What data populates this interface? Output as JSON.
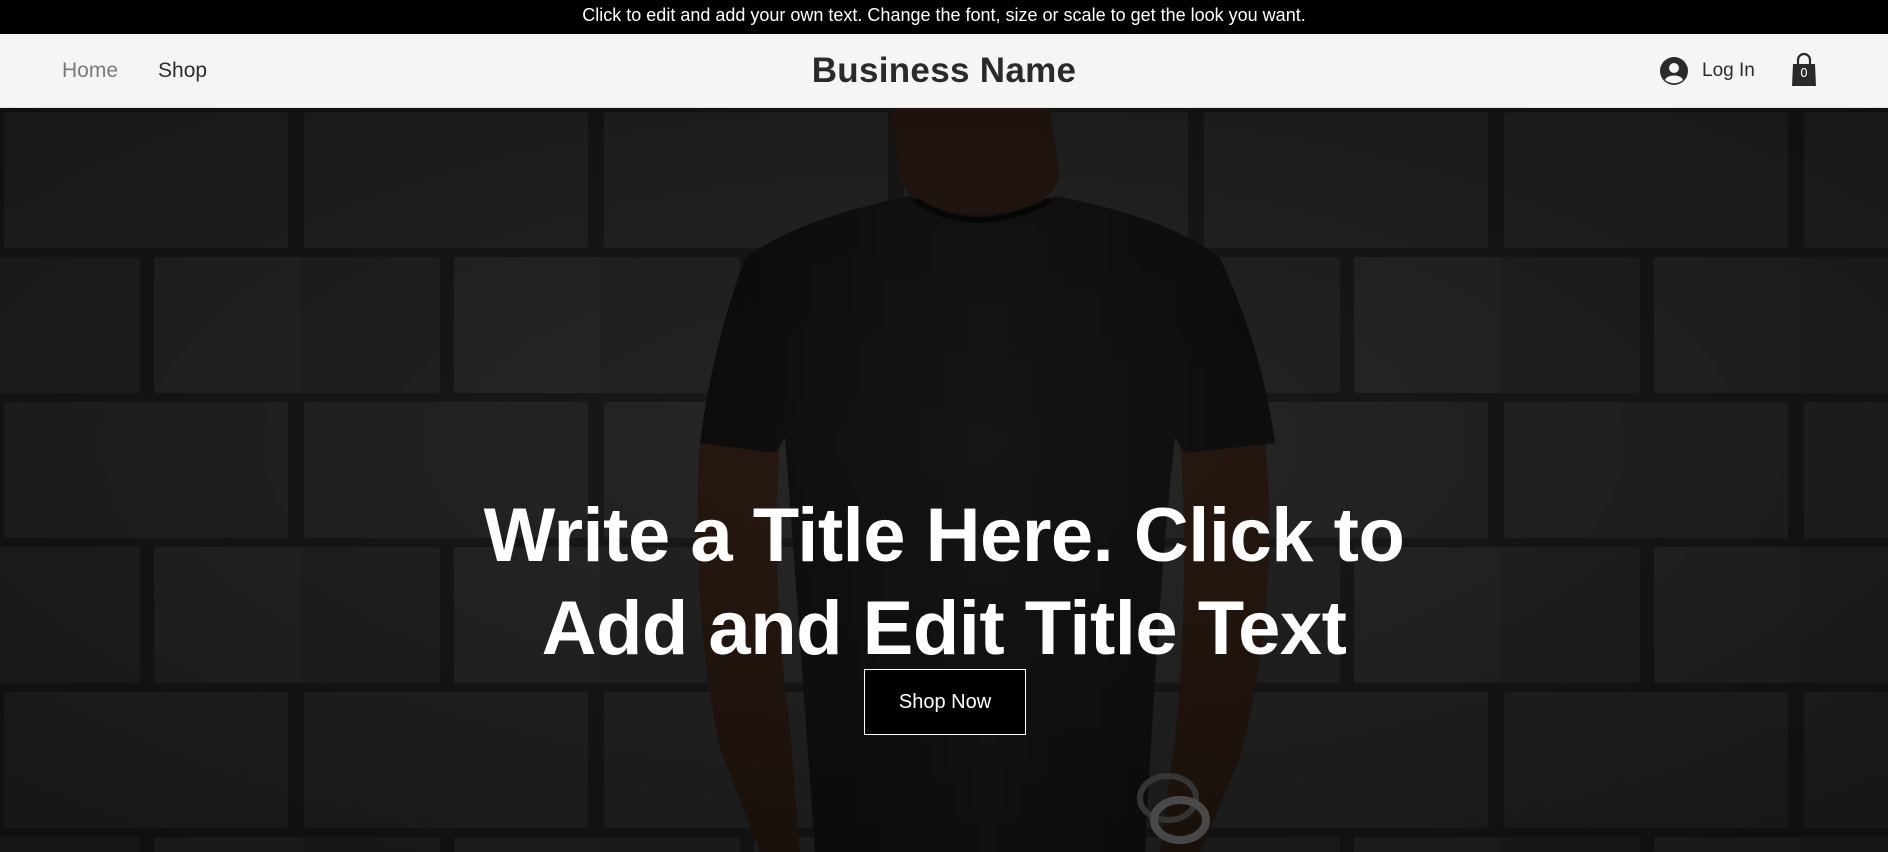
{
  "announcement": {
    "text": "Click to edit and add your own text. Change the font, size or scale to get the look you want."
  },
  "header": {
    "nav": [
      {
        "label": "Home",
        "active": true
      },
      {
        "label": "Shop",
        "active": false
      }
    ],
    "brand": "Business Name",
    "login_label": "Log In",
    "login_icon": "user-avatar-icon",
    "cart_icon": "shopping-bag-icon",
    "cart_count": "0"
  },
  "hero": {
    "title_line1": "Write a Title Here. Click to",
    "title_line2": "Add and Edit Title Text",
    "cta_label": "Shop Now",
    "background": "dark stone brick wall with person in black t-shirt"
  },
  "colors": {
    "announcement_bg": "#000000",
    "header_bg": "#f5f5f5",
    "text_dark": "#2a2a2a",
    "nav_active": "#7a7a7a",
    "hero_text": "#ffffff",
    "button_bg": "#000000"
  }
}
